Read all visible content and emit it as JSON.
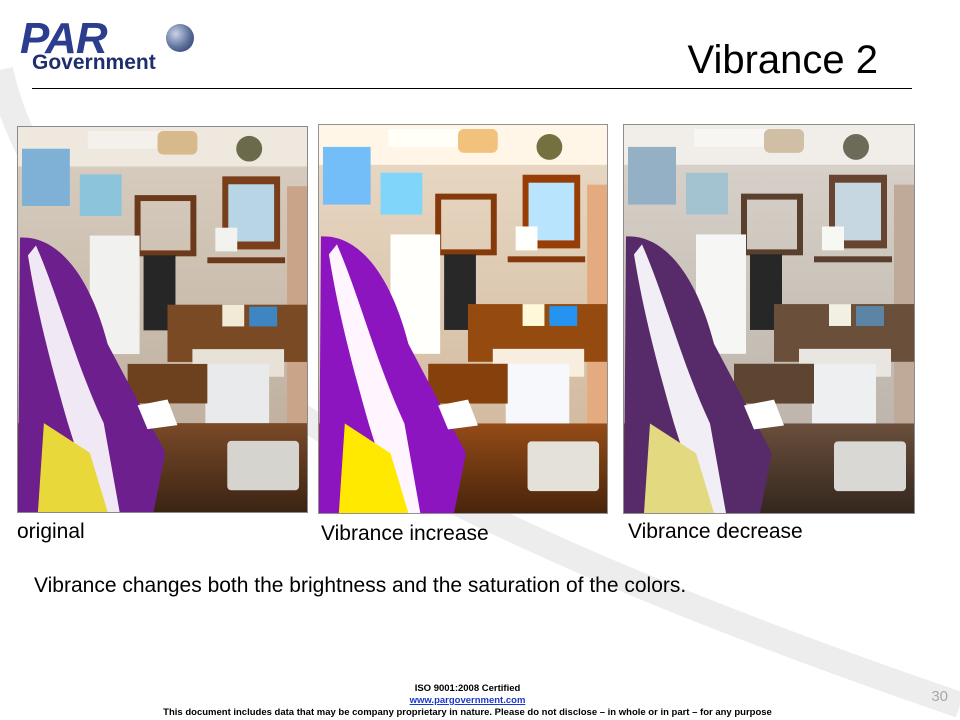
{
  "logo": {
    "brand": "PAR",
    "subtitle": "Government"
  },
  "title": "Vibrance 2",
  "photos": [
    {
      "caption": "original"
    },
    {
      "caption": "Vibrance increase"
    },
    {
      "caption": "Vibrance decrease"
    }
  ],
  "body_text": "Vibrance changes both the brightness and the saturation of the colors.",
  "footer": {
    "certification": "ISO 9001:2008 Certified",
    "website": "www.pargovernment.com",
    "disclaimer": "This document includes data that may be company proprietary in nature. Please do not disclose – in whole or in part – for any purpose"
  },
  "page_number": "30",
  "colors": {
    "brand_blue": "#2b3d8c",
    "link_blue": "#1a39c9",
    "page_number_gray": "#a7a7a7"
  }
}
